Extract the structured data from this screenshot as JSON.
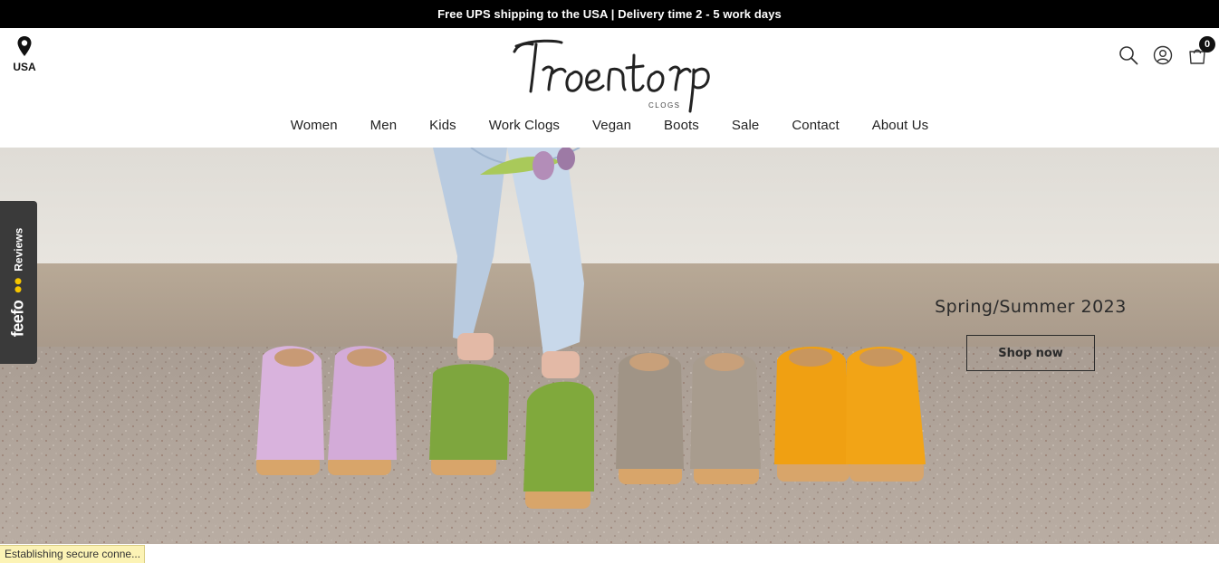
{
  "announcement": {
    "text": "Free UPS shipping to the USA | Delivery time 2 - 5 work days"
  },
  "locator": {
    "icon": "map-pin-icon",
    "country": "USA"
  },
  "logo": {
    "text": "Troentorp",
    "subtext": "CLOGS"
  },
  "tools": {
    "search_icon": "search-icon",
    "account_icon": "user-icon",
    "cart_icon": "shopping-bag-icon",
    "cart_count": "0"
  },
  "nav": {
    "items": [
      {
        "label": "Women"
      },
      {
        "label": "Men"
      },
      {
        "label": "Kids"
      },
      {
        "label": "Work Clogs"
      },
      {
        "label": "Vegan"
      },
      {
        "label": "Boots"
      },
      {
        "label": "Sale"
      },
      {
        "label": "Contact"
      },
      {
        "label": "About Us"
      }
    ]
  },
  "hero": {
    "title": "Spring/Summer 2023",
    "cta_label": "Shop now",
    "clog_colors": [
      "#d9b3dd",
      "#7ea63e",
      "#a09486",
      "#f0a012"
    ]
  },
  "feefo": {
    "brand": "feefo",
    "label": "Reviews",
    "accent": "#f5c500"
  },
  "browser_status": {
    "text": "Establishing secure conne..."
  }
}
